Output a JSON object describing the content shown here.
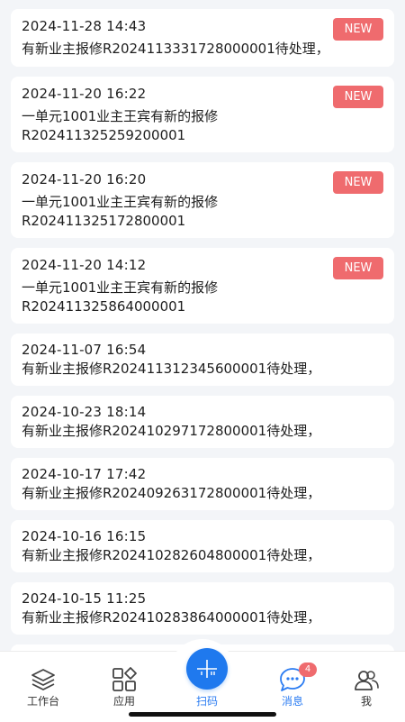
{
  "messages": [
    {
      "time": "2024-11-28 14:43",
      "line1": "有新业主报修R2024113331728000001待处理，",
      "line2": "",
      "badge": "NEW"
    },
    {
      "time": "2024-11-20 16:22",
      "line1": "一单元1001业主王宾有新的报修",
      "line2": "R202411325259200001",
      "badge": "NEW"
    },
    {
      "time": "2024-11-20 16:20",
      "line1": "一单元1001业主王宾有新的报修",
      "line2": "R202411325172800001",
      "badge": "NEW"
    },
    {
      "time": "2024-11-20 14:12",
      "line1": "一单元1001业主王宾有新的报修",
      "line2": "R202411325864000001",
      "badge": "NEW"
    },
    {
      "time": "2024-11-07 16:54",
      "line1": "有新业主报修R202411312345600001待处理，",
      "line2": "",
      "badge": ""
    },
    {
      "time": "2024-10-23 18:14",
      "line1": "有新业主报修R202410297172800001待处理，",
      "line2": "",
      "badge": ""
    },
    {
      "time": "2024-10-17 17:42",
      "line1": "有新业主报修R202409263172800001待处理，",
      "line2": "",
      "badge": ""
    },
    {
      "time": "2024-10-16 16:15",
      "line1": "有新业主报修R202410282604800001待处理，",
      "line2": "",
      "badge": ""
    },
    {
      "time": "2024-10-15 11:25",
      "line1": "有新业主报修R202410283864000001待处理，",
      "line2": "",
      "badge": ""
    }
  ],
  "tabbar": {
    "workbench": "工作台",
    "apps": "应用",
    "scan": "扫码",
    "messages": "消息",
    "messages_count": "4",
    "me": "我"
  },
  "colors": {
    "accent": "#1f79ee",
    "badge": "#ef6b6e",
    "background": "#f3f5f8"
  }
}
